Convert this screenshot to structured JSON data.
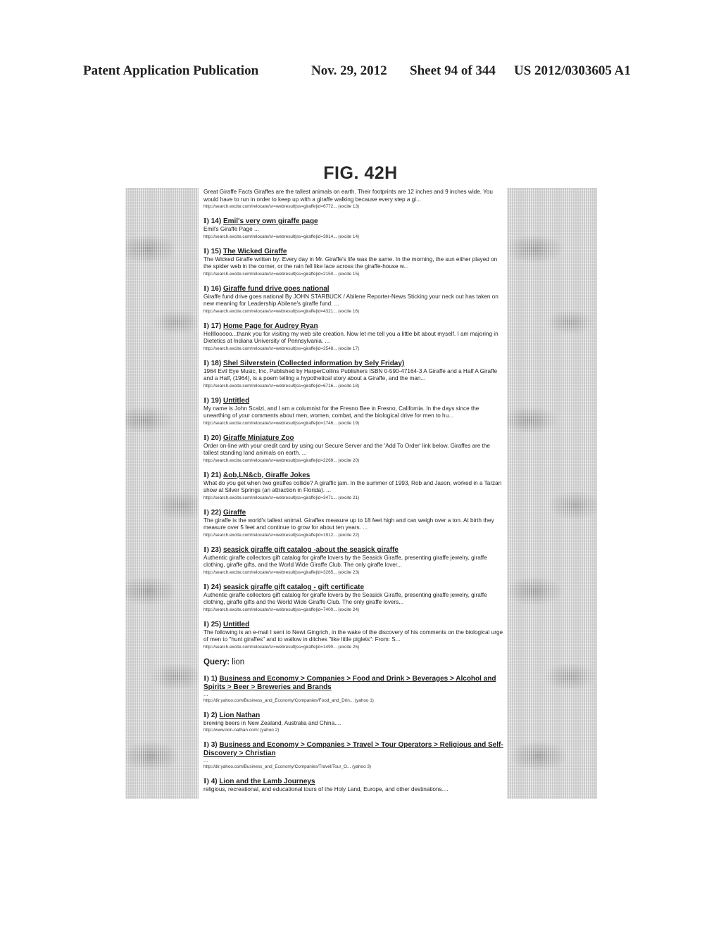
{
  "header": {
    "publication": "Patent Application Publication",
    "date": "Nov. 29, 2012",
    "sheet": "Sheet 94 of 344",
    "patent_number": "US 2012/0303605 A1"
  },
  "figure_title": "FIG. 42H",
  "lead": {
    "snippet": "Great Giraffe Facts Giraffes are the tallest animals on earth. Their footprints are 12 inches and 9 inches wide. You would have to run in order to keep up with a giraffe walking because every step a gi...",
    "url": "http://search.excite.com/relocate/sr=webresult|ss=giraffe|id=6772...   (excite  13)"
  },
  "giraffe_results": [
    {
      "marker": "I)",
      "num": "14)",
      "title": "Emil's very own giraffe page",
      "snippet": "Emil's Giraffe Page ...",
      "url": "http://search.excite.com/relocate/sr=webresult|ss=giraffe|id=3914...   (excite  14)"
    },
    {
      "marker": "I)",
      "num": "15)",
      "title": "The Wicked Giraffe",
      "snippet": "The Wicked Giraffe written by: Every day in Mr. Giraffe's life was the same. In the morning, the sun either played on the spider web in the corner, or the rain fell like lace across the giraffe-house w...",
      "url": "http://search.excite.com/relocate/sr=webresult|ss=giraffe|id=2150...   (excite  15)"
    },
    {
      "marker": "I)",
      "num": "16)",
      "title": "Giraffe fund drive goes national",
      "snippet": "Giraffe fund drive goes national By JOHN STARBUCK / Abilene Reporter-News Sticking your neck out has taken on new meaning for Leadership Abilene's giraffe fund. ...",
      "url": "http://search.excite.com/relocate/sr=webresult|ss=giraffe|id=4321...   (excite  16)"
    },
    {
      "marker": "I)",
      "num": "17)",
      "title": "Home Page for Audrey Ryan",
      "snippet": "Hellllooooo...thank you for visiting my web site creation. Now let me tell you a little bit about myself. I am majoring in Dietetics at Indiana University of Pennsylvania. ...",
      "url": "http://search.excite.com/relocate/sr=webresult|ss=giraffe|id=2548...   (excite  17)"
    },
    {
      "marker": "I)",
      "num": "18)",
      "title": "Shel Silverstein (Collected information by Sely Friday)",
      "snippet": "1964 Evil Eye Music, Inc. Published by HarperCollins Publishers ISBN 0-590-47164-3 A Giraffe and a Half A Giraffe and a Half, (1964), is a poem telling a hypothetical story about a Giraffe, and the man...",
      "url": "http://search.excite.com/relocate/sr=webresult|ss=giraffe|id=6716...   (excite  18)"
    },
    {
      "marker": "I)",
      "num": "19)",
      "title": "Untitled",
      "snippet": "My name is John Scalzi, and I am a columnist for the Fresno Bee in Fresno, California. In the days since the unearthing of your comments about men, women, combat, and the biological drive for men to hu...",
      "url": "http://search.excite.com/relocate/sr=webresult|ss=giraffe|id=1746...   (excite  19)"
    },
    {
      "marker": "I)",
      "num": "20)",
      "title": "Giraffe Miniature Zoo",
      "snippet": "Order on-line with your credit card by using our Secure Server and the 'Add To Order' link below. Giraffes are the tallest standing land animals on earth. ...",
      "url": "http://search.excite.com/relocate/sr=webresult|ss=giraffe|id=2269...   (excite  20)"
    },
    {
      "marker": "I)",
      "num": "21)",
      "title": "&ob,LN&cb, Giraffe Jokes",
      "snippet": "What do you get when two giraffes collide? A giraffic jam. In the summer of 1993, Rob and Jason, worked in a Tarzan show at Silver Springs (an attraction in Florida). ...",
      "url": "http://search.excite.com/relocate/sr=webresult|ss=giraffe|id=3471...   (excite  21)"
    },
    {
      "marker": "I)",
      "num": "22)",
      "title": "Giraffe",
      "snippet": "The giraffe is the world's tallest animal. Giraffes measure up to 18 feet high and can weigh over a ton. At birth they measure over 5 feet and continue to grow for about ten years. ...",
      "url": "http://search.excite.com/relocate/sr=webresult|ss=giraffe|id=1912...   (excite  22)"
    },
    {
      "marker": "I)",
      "num": "23)",
      "title": "seasick giraffe gift catalog -about the seasick giraffe",
      "snippet": "Authentic giraffe collectors gift catalog for giraffe lovers by the Seasick Giraffe, presenting giraffe jewelry, giraffe clothing, giraffe gifts, and the World Wide Giraffe Club. The only giraffe lover...",
      "url": "http://search.excite.com/relocate/sr=webresult|ss=giraffe|id=3265...   (excite  23)"
    },
    {
      "marker": "I)",
      "num": "24)",
      "title": "seasick giraffe gift catalog - gift certificate",
      "snippet": "Authentic giraffe collectors gift catalog for giraffe lovers by the Seasick Giraffe, presenting giraffe jewelry, giraffe clothing, giraffe gifts and the World Wide Giraffe Club. The only giraffe lovers...",
      "url": "http://search.excite.com/relocate/sr=webresult|ss=giraffe|id=7400...   (excite  24)"
    },
    {
      "marker": "I)",
      "num": "25)",
      "title": "Untitled",
      "snippet": "The following is an e-mail I sent to Newt Gingrich, in the wake of the discovery of his comments on the biological urge of men to \"hunt giraffes\" and to wallow in ditches \"like little piglets\": From: S...",
      "url": "http://search.excite.com/relocate/sr=webresult|ss=giraffe|id=1490...   (excite  25)"
    }
  ],
  "query": {
    "label": "Query:",
    "value": "lion"
  },
  "lion_results": [
    {
      "marker": "I)",
      "num": "1)",
      "title": "Business and Economy > Companies > Food and Drink > Beverages > Alcohol and Spirits > Beer > Breweries and Brands",
      "snippet": "...",
      "url": "http://dir.yahoo.com/Business_and_Economy/Companies/Food_and_Drin...   (yahoo  1)"
    },
    {
      "marker": "I)",
      "num": "2)",
      "title": "Lion Nathan",
      "snippet": "brewing beers in New Zealand, Australia and China....",
      "url": "http://www.lion-nathan.com/   (yahoo  2)"
    },
    {
      "marker": "I)",
      "num": "3)",
      "title": "Business and Economy > Companies > Travel > Tour Operators > Religious and Self-Discovery > Christian",
      "snippet": "...",
      "url": "http://dir.yahoo.com/Business_and_Economy/Companies/Travel/Tour_O...   (yahoo  3)"
    },
    {
      "marker": "I)",
      "num": "4)",
      "title": "Lion and the Lamb Journeys",
      "snippet": "religious, recreational, and educational tours of the Holy Land, Europe, and other destinations....",
      "url": ""
    }
  ]
}
